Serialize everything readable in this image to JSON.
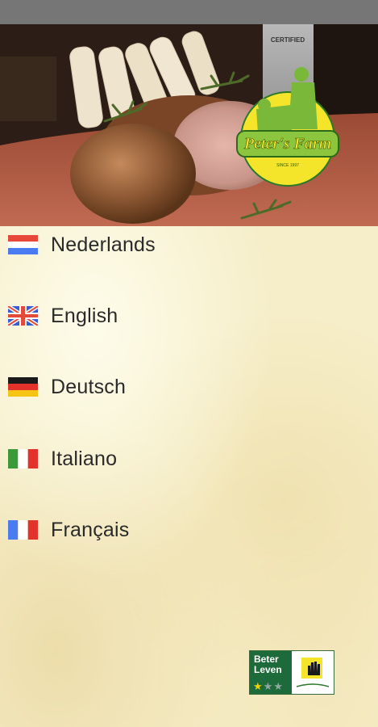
{
  "brand": {
    "badge_text": "CERTIFIED",
    "logo_text": "Peter's Farm",
    "logo_tagline": "SINCE 1997"
  },
  "languages": [
    {
      "id": "nl",
      "label": "Nederlands",
      "flag_icon": "netherlands-flag-icon"
    },
    {
      "id": "en",
      "label": "English",
      "flag_icon": "uk-flag-icon"
    },
    {
      "id": "de",
      "label": "Deutsch",
      "flag_icon": "germany-flag-icon"
    },
    {
      "id": "it",
      "label": "Italiano",
      "flag_icon": "italy-flag-icon"
    },
    {
      "id": "fr",
      "label": "Français",
      "flag_icon": "france-flag-icon"
    }
  ],
  "beter_leven": {
    "line1": "Beter",
    "line2": "Leven",
    "stars_total": 3,
    "stars_awarded": 1
  },
  "colors": {
    "status_bar": "#767676",
    "parchment": "#f6eec9",
    "logo_green": "#8cc63f",
    "logo_yellow": "#f5e52a",
    "beter_leven_green": "#1d6b3a"
  }
}
